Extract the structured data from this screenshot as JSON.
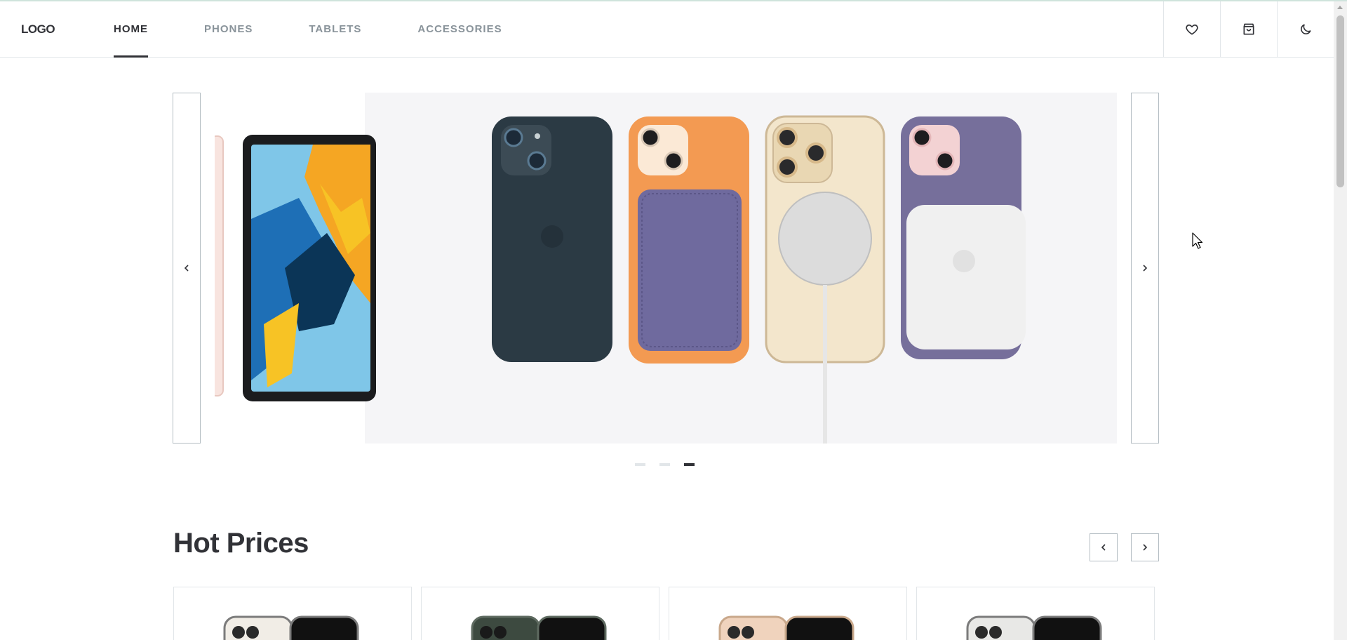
{
  "header": {
    "logo": "LOGO",
    "nav": [
      "HOME",
      "PHONES",
      "TABLETS",
      "ACCESSORIES"
    ],
    "active_nav": "HOME",
    "icons": [
      "heart-icon",
      "cart-icon",
      "moon-icon"
    ]
  },
  "banner": {
    "slides_total": 3,
    "active_slide": 3,
    "prev_icon": "chevron-left-icon",
    "next_icon": "chevron-right-icon"
  },
  "hot_prices": {
    "title": "Hot Prices",
    "cards": [
      {
        "color": "#f1ede6"
      },
      {
        "color": "#3d4a40"
      },
      {
        "color": "#f0d3bd"
      },
      {
        "color": "#e8e8e6"
      }
    ]
  },
  "colors": {
    "primary": "#313237",
    "secondary": "#89939a",
    "border": "#b4bdc3",
    "elements": "#e2e6e9"
  }
}
